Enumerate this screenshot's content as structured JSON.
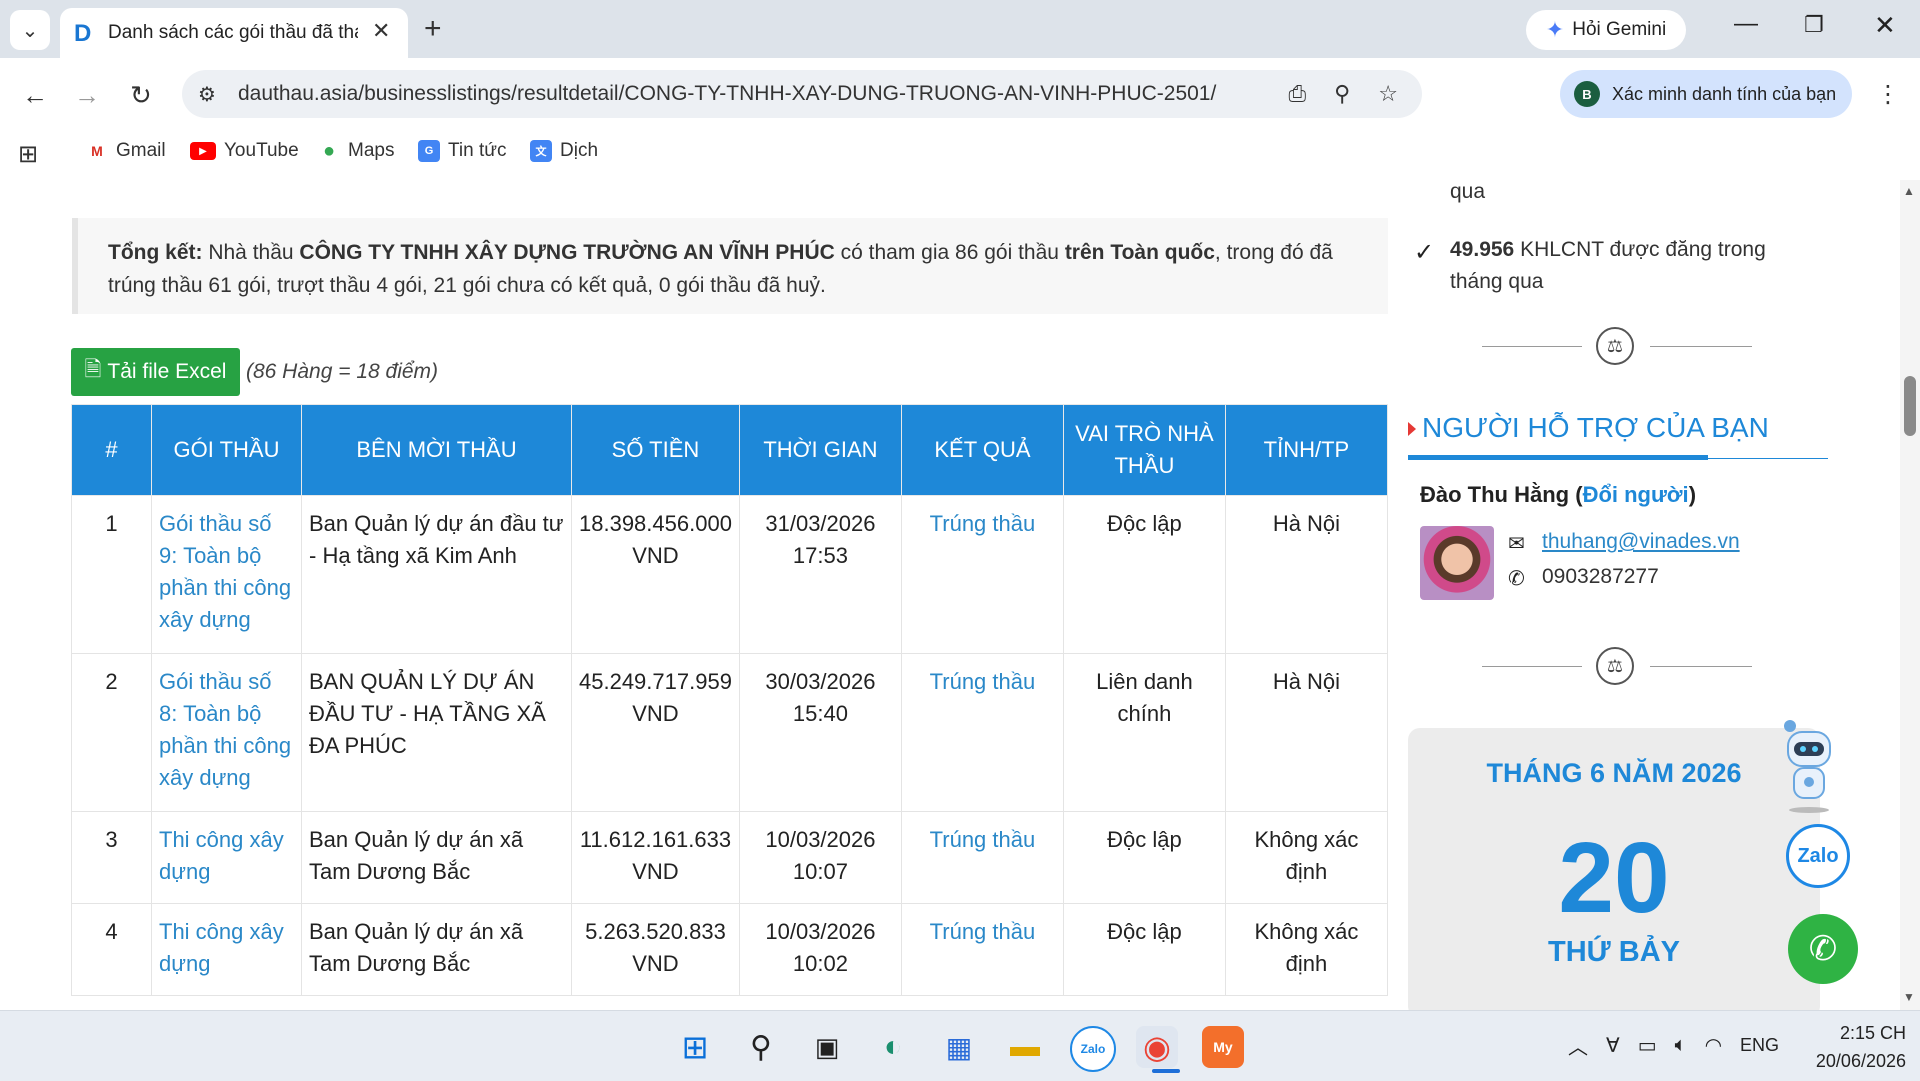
{
  "browser": {
    "tab_title": "Danh sách các gói thầu đã than",
    "new_tab_symbol": "+",
    "gemini_label": "Hỏi Gemini",
    "url": "dauthau.asia/businesslistings/resultdetail/CONG-TY-TNHH-XAY-DUNG-TRUONG-AN-VINH-PHUC-2501/",
    "profile_label": "Xác minh danh tính của bạn",
    "profile_initial": "B"
  },
  "bookmarks": [
    {
      "label": "Gmail",
      "icon": "gmail-icon"
    },
    {
      "label": "YouTube",
      "icon": "youtube-icon"
    },
    {
      "label": "Maps",
      "icon": "maps-icon"
    },
    {
      "label": "Tin tức",
      "icon": "news-icon"
    },
    {
      "label": "Dịch",
      "icon": "translate-icon"
    }
  ],
  "summary": {
    "label": "Tổng kết:",
    "t1": " Nhà thầu ",
    "company": "CÔNG TY TNHH XÂY DỰNG TRƯỜNG AN VĨNH PHÚC",
    "t2": " có tham gia 86 gói thầu ",
    "scope": "trên Toàn quốc",
    "t3": ", trong đó đã trúng thầu 61 gói, trượt thầu 4 gói, 21 gói chưa có kết quả, 0 gói thầu đã huỷ."
  },
  "excel": {
    "button_label": "Tải file Excel",
    "note": "(86 Hàng = 18 điểm)"
  },
  "table": {
    "headers": [
      "#",
      "GÓI THẦU",
      "BÊN MỜI THẦU",
      "SỐ TIỀN",
      "THỜI GIAN",
      "KẾT QUẢ",
      "VAI TRÒ NHÀ THẦU",
      "TỈNH/TP"
    ],
    "rows": [
      {
        "no": "1",
        "package": "Gói thầu số 9: Toàn bộ phần thi công xây dựng",
        "inviter": "Ban Quản lý dự án đầu tư - Hạ tầng xã Kim Anh",
        "amount": "18.398.456.000",
        "currency": "VND",
        "date": "31/03/2026",
        "time": "17:53",
        "result": "Trúng thầu",
        "role": "Độc lập",
        "province": "Hà Nội"
      },
      {
        "no": "2",
        "package": "Gói thầu số 8: Toàn bộ phần thi công xây dựng",
        "inviter": "BAN QUẢN LÝ DỰ ÁN ĐẦU TƯ - HẠ TẦNG XÃ ĐA PHÚC",
        "amount": "45.249.717.959",
        "currency": "VND",
        "date": "30/03/2026",
        "time": "15:40",
        "result": "Trúng thầu",
        "role": "Liên danh chính",
        "province": "Hà Nội"
      },
      {
        "no": "3",
        "package": "Thi công xây dựng",
        "inviter": "Ban Quản lý dự án xã Tam Dương Bắc",
        "amount": "11.612.161.633",
        "currency": "VND",
        "date": "10/03/2026",
        "time": "10:07",
        "result": "Trúng thầu",
        "role": "Độc lập",
        "province": "Không xác định"
      },
      {
        "no": "4",
        "package": "Thi công xây dựng",
        "inviter": "Ban Quản lý dự án xã Tam Dương Bắc",
        "amount": "5.263.520.833",
        "currency": "VND",
        "date": "10/03/2026",
        "time": "10:02",
        "result": "Trúng thầu",
        "role": "Độc lập",
        "province": "Không xác định"
      }
    ]
  },
  "sidebar": {
    "partial_line": "qua",
    "stat_value": "49.956",
    "stat_text": " KHLCNT được đăng trong tháng qua",
    "support_title": "NGƯỜI HỖ TRỢ CỦA BẠN",
    "supporter_name": "Đào Thu Hằng",
    "change_open": " (",
    "change_label": "Đổi người",
    "change_close": ")",
    "email": "thuhang@vinades.vn",
    "phone": "0903287277",
    "calendar_month": "THÁNG 6 NĂM 2026",
    "calendar_day": "20",
    "calendar_weekday": "THỨ BẢY",
    "zalo_label": "Zalo"
  },
  "taskbar": {
    "language": "ENG",
    "time": "2:15 CH",
    "date": "20/06/2026"
  },
  "colors": {
    "accent_blue": "#1e88d8",
    "excel_green": "#27a243",
    "link_blue": "#2a88c8"
  }
}
